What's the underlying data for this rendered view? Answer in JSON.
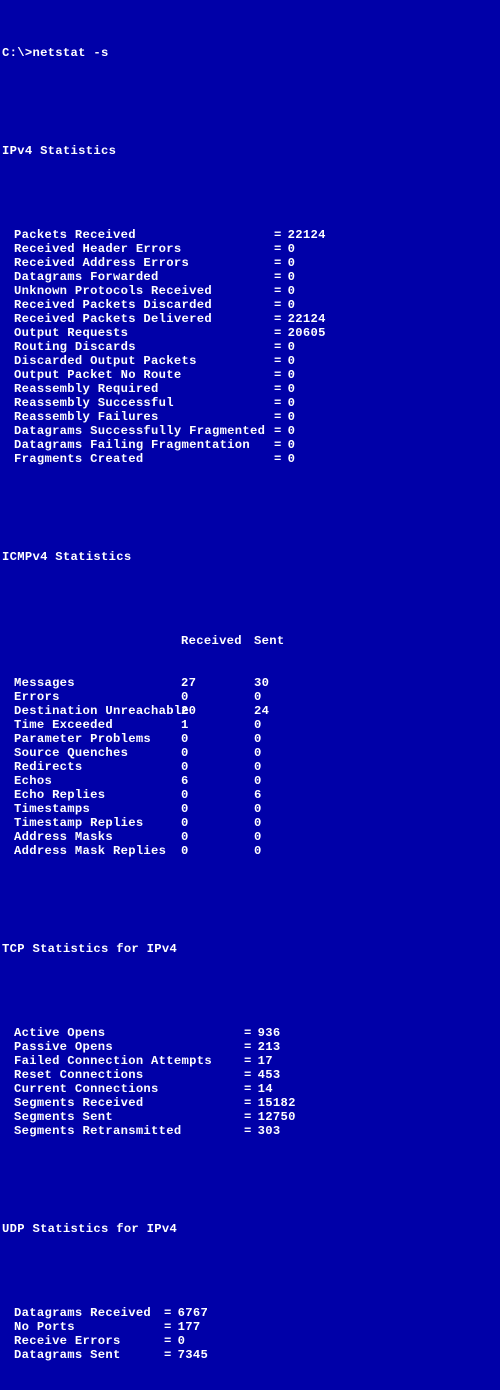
{
  "prompt": "C:\\>netstat -s",
  "ipv4": {
    "title": "IPv4 Statistics",
    "rows": [
      {
        "label": "Packets Received",
        "value": "22124"
      },
      {
        "label": "Received Header Errors",
        "value": "0"
      },
      {
        "label": "Received Address Errors",
        "value": "0"
      },
      {
        "label": "Datagrams Forwarded",
        "value": "0"
      },
      {
        "label": "Unknown Protocols Received",
        "value": "0"
      },
      {
        "label": "Received Packets Discarded",
        "value": "0"
      },
      {
        "label": "Received Packets Delivered",
        "value": "22124"
      },
      {
        "label": "Output Requests",
        "value": "20605"
      },
      {
        "label": "Routing Discards",
        "value": "0"
      },
      {
        "label": "Discarded Output Packets",
        "value": "0"
      },
      {
        "label": "Output Packet No Route",
        "value": "0"
      },
      {
        "label": "Reassembly Required",
        "value": "0"
      },
      {
        "label": "Reassembly Successful",
        "value": "0"
      },
      {
        "label": "Reassembly Failures",
        "value": "0"
      },
      {
        "label": "Datagrams Successfully Fragmented",
        "value": "0"
      },
      {
        "label": "Datagrams Failing Fragmentation",
        "value": "0"
      },
      {
        "label": "Fragments Created",
        "value": "0"
      }
    ]
  },
  "icmp": {
    "title": "ICMPv4 Statistics",
    "head_received": "Received",
    "head_sent": "Sent",
    "rows": [
      {
        "label": "Messages",
        "received": "27",
        "sent": "30"
      },
      {
        "label": "Errors",
        "received": "0",
        "sent": "0"
      },
      {
        "label": "Destination Unreachable",
        "received": "20",
        "sent": "24"
      },
      {
        "label": "Time Exceeded",
        "received": "1",
        "sent": "0"
      },
      {
        "label": "Parameter Problems",
        "received": "0",
        "sent": "0"
      },
      {
        "label": "Source Quenches",
        "received": "0",
        "sent": "0"
      },
      {
        "label": "Redirects",
        "received": "0",
        "sent": "0"
      },
      {
        "label": "Echos",
        "received": "6",
        "sent": "0"
      },
      {
        "label": "Echo Replies",
        "received": "0",
        "sent": "6"
      },
      {
        "label": "Timestamps",
        "received": "0",
        "sent": "0"
      },
      {
        "label": "Timestamp Replies",
        "received": "0",
        "sent": "0"
      },
      {
        "label": "Address Masks",
        "received": "0",
        "sent": "0"
      },
      {
        "label": "Address Mask Replies",
        "received": "0",
        "sent": "0"
      }
    ]
  },
  "tcp": {
    "title": "TCP Statistics for IPv4",
    "rows": [
      {
        "label": "Active Opens",
        "value": "936"
      },
      {
        "label": "Passive Opens",
        "value": "213"
      },
      {
        "label": "Failed Connection Attempts",
        "value": "17"
      },
      {
        "label": "Reset Connections",
        "value": "453"
      },
      {
        "label": "Current Connections",
        "value": "14"
      },
      {
        "label": "Segments Received",
        "value": "15182"
      },
      {
        "label": "Segments Sent",
        "value": "12750"
      },
      {
        "label": "Segments Retransmitted",
        "value": "303"
      }
    ]
  },
  "udp": {
    "title": "UDP Statistics for IPv4",
    "rows": [
      {
        "label": "Datagrams Received",
        "value": "6767"
      },
      {
        "label": "No Ports",
        "value": "177"
      },
      {
        "label": "Receive Errors",
        "value": "0"
      },
      {
        "label": "Datagrams Sent",
        "value": "7345"
      }
    ]
  }
}
